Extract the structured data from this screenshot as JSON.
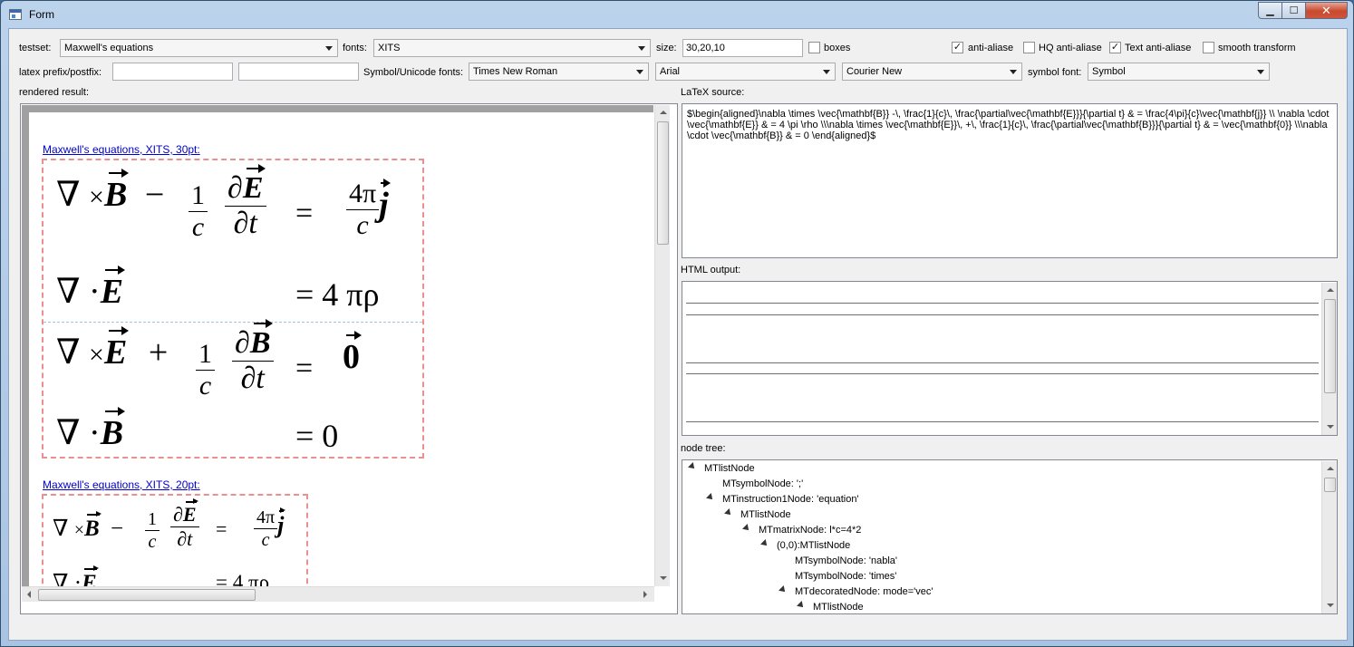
{
  "window": {
    "title": "Form",
    "buttons": {
      "minimize": "▁",
      "maximize": "☐",
      "close": "✕"
    }
  },
  "toolbar": {
    "testset_label": "testset:",
    "testset_value": "Maxwell's equations",
    "fonts_label": "fonts:",
    "fonts_value": "XITS",
    "size_label": "size:",
    "size_value": "30,20,10",
    "boxes_label": "boxes",
    "boxes_checked": false,
    "antialias_label": "anti-aliase",
    "antialias_checked": true,
    "hq_antialias_label": "HQ anti-aliase",
    "hq_antialias_checked": false,
    "text_antialias_label": "Text anti-aliase",
    "text_antialias_checked": true,
    "smooth_label": "smooth transform",
    "smooth_checked": false,
    "latex_prefix_label": "latex prefix/postfix:",
    "latex_prefix_value": "",
    "latex_postfix_value": "",
    "symbol_unicode_label": "Symbol/Unicode fonts:",
    "font_roman": "Times New Roman",
    "font_sans": "Arial",
    "font_mono": "Courier New",
    "symbol_font_label": "symbol font:",
    "symbol_font_value": "Symbol"
  },
  "rendered": {
    "label": "rendered result:",
    "caption30": "Maxwell's equations, XITS, 30pt:",
    "caption20": "Maxwell's equations, XITS, 20pt:",
    "eq": {
      "nabla": "∇",
      "times": "×",
      "cdot": "·",
      "minus": "−",
      "plus": "+",
      "eq": "=",
      "B": "B",
      "E": "E",
      "j": "j",
      "one": "1",
      "c": "c",
      "dE": "∂E",
      "dB": "∂B",
      "dt": "∂t",
      "fourpi": "4π",
      "rhs2": "= 4  πρ",
      "zero_vec": "0",
      "rhs4": "= 0"
    }
  },
  "latex": {
    "label": "LaTeX source:",
    "source": "$\\begin{aligned}\\nabla \\times \\vec{\\mathbf{B}} -\\, \\frac{1}{c}\\, \\frac{\\partial\\vec{\\mathbf{E}}}{\\partial t} & = \\frac{4\\pi}{c}\\vec{\\mathbf{j}} \\\\ \\nabla \\cdot \\vec{\\mathbf{E}} & = 4 \\pi \\rho \\\\\\nabla \\times \\vec{\\mathbf{E}}\\, +\\, \\frac{1}{c}\\, \\frac{\\partial\\vec{\\mathbf{B}}}{\\partial t} & = \\vec{\\mathbf{0}} \\\\\\nabla \\cdot \\vec{\\mathbf{B}} & = 0 \\end{aligned}$"
  },
  "html_output": {
    "label": "HTML output:"
  },
  "node_tree": {
    "label": "node tree:",
    "rows": [
      {
        "text": "MTlistNode",
        "expanded": true
      },
      {
        "text": "MTsymbolNode: ';'",
        "expanded": false
      },
      {
        "text": "MTinstruction1Node: 'equation'",
        "expanded": true
      },
      {
        "text": "MTlistNode",
        "expanded": true
      },
      {
        "text": "MTmatrixNode: l*c=4*2",
        "expanded": true
      },
      {
        "text": "(0,0):MTlistNode",
        "expanded": true
      },
      {
        "text": "MTsymbolNode: 'nabla'",
        "expanded": false
      },
      {
        "text": "MTsymbolNode: 'times'",
        "expanded": false
      },
      {
        "text": "MTdecoratedNode: mode='vec'",
        "expanded": true
      },
      {
        "text": "MTlistNode",
        "expanded": true
      }
    ]
  }
}
